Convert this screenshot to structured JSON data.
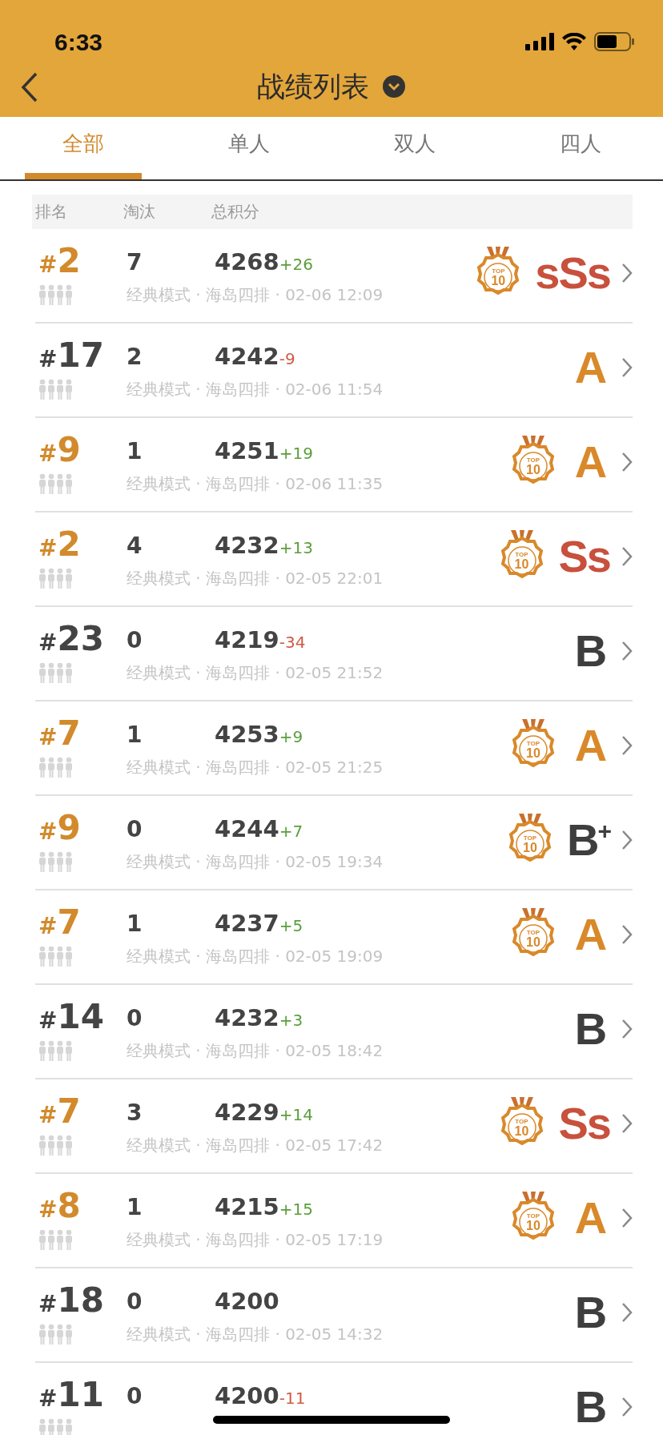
{
  "status_bar": {
    "time": "6:33"
  },
  "header": {
    "title": "战绩列表"
  },
  "tabs": [
    {
      "label": "全部",
      "selected": true
    },
    {
      "label": "单人",
      "selected": false
    },
    {
      "label": "双人",
      "selected": false
    },
    {
      "label": "四人",
      "selected": false
    }
  ],
  "table": {
    "columns": [
      "排名",
      "淘汰",
      "总积分"
    ],
    "rows": [
      {
        "rank_mark": "#",
        "rank": "2",
        "kills": "7",
        "score": "4268",
        "delta": {
          "text": "+26",
          "kind": "gain"
        },
        "meta": "经典模式 · 海岛四排 · 02-06 12:09",
        "medal": {
          "top": "TOP",
          "num": "10"
        },
        "grade": {
          "text": "sSs",
          "color": "#c8503c"
        }
      },
      {
        "rank_mark": "#",
        "rank": "17",
        "kills": "2",
        "score": "4242",
        "delta": {
          "text": "-9",
          "kind": "loss"
        },
        "meta": "经典模式 · 海岛四排 · 02-06 11:54",
        "grade": {
          "text": "A",
          "color": "#d9892a"
        }
      },
      {
        "rank_mark": "#",
        "rank": "9",
        "kills": "1",
        "score": "4251",
        "delta": {
          "text": "+19",
          "kind": "gain"
        },
        "meta": "经典模式 · 海岛四排 · 02-06 11:35",
        "medal": {
          "top": "TOP",
          "num": "10"
        },
        "grade": {
          "text": "A",
          "color": "#d9892a"
        }
      },
      {
        "rank_mark": "#",
        "rank": "2",
        "kills": "4",
        "score": "4232",
        "delta": {
          "text": "+13",
          "kind": "gain"
        },
        "meta": "经典模式 · 海岛四排 · 02-05 22:01",
        "medal": {
          "top": "TOP",
          "num": "10"
        },
        "grade": {
          "text": "Ss",
          "color": "#c8503c"
        }
      },
      {
        "rank_mark": "#",
        "rank": "23",
        "kills": "0",
        "score": "4219",
        "delta": {
          "text": "-34",
          "kind": "loss"
        },
        "meta": "经典模式 · 海岛四排 · 02-05 21:52",
        "grade": {
          "text": "B",
          "color": "#3e3e3e"
        }
      },
      {
        "rank_mark": "#",
        "rank": "7",
        "kills": "1",
        "score": "4253",
        "delta": {
          "text": "+9",
          "kind": "gain"
        },
        "meta": "经典模式 · 海岛四排 · 02-05 21:25",
        "medal": {
          "top": "TOP",
          "num": "10"
        },
        "grade": {
          "text": "A",
          "color": "#d9892a"
        }
      },
      {
        "rank_mark": "#",
        "rank": "9",
        "kills": "0",
        "score": "4244",
        "delta": {
          "text": "+7",
          "kind": "gain"
        },
        "meta": "经典模式 · 海岛四排 · 02-05 19:34",
        "medal": {
          "top": "TOP",
          "num": "10"
        },
        "grade": {
          "text": "B$^{+}$",
          "color": "#3e3e3e"
        }
      },
      {
        "rank_mark": "#",
        "rank": "7",
        "kills": "1",
        "score": "4237",
        "delta": {
          "text": "+5",
          "kind": "gain"
        },
        "meta": "经典模式 · 海岛四排 · 02-05 19:09",
        "medal": {
          "top": "TOP",
          "num": "10"
        },
        "grade": {
          "text": "A",
          "color": "#d9892a"
        }
      },
      {
        "rank_mark": "#",
        "rank": "14",
        "kills": "0",
        "score": "4232",
        "delta": {
          "text": "+3",
          "kind": "gain"
        },
        "meta": "经典模式 · 海岛四排 · 02-05 18:42",
        "grade": {
          "text": "B",
          "color": "#3e3e3e"
        }
      },
      {
        "rank_mark": "#",
        "rank": "7",
        "kills": "3",
        "score": "4229",
        "delta": {
          "text": "+14",
          "kind": "gain"
        },
        "meta": "经典模式 · 海岛四排 · 02-05 17:42",
        "medal": {
          "top": "TOP",
          "num": "10"
        },
        "grade": {
          "text": "Ss",
          "color": "#c8503c"
        }
      },
      {
        "rank_mark": "#",
        "rank": "8",
        "kills": "1",
        "score": "4215",
        "delta": {
          "text": "+15",
          "kind": "gain"
        },
        "meta": "经典模式 · 海岛四排 · 02-05 17:19",
        "medal": {
          "top": "TOP",
          "num": "10"
        },
        "grade": {
          "text": "A",
          "color": "#d9892a"
        }
      },
      {
        "rank_mark": "#",
        "rank": "18",
        "kills": "0",
        "score": "4200",
        "meta": "经典模式 · 海岛四排 · 02-05 14:32",
        "grade": {
          "text": "B",
          "color": "#3e3e3e"
        }
      },
      {
        "rank_mark": "#",
        "rank": "11",
        "kills": "0",
        "score": "4200",
        "delta": {
          "text": "-11",
          "kind": "loss"
        },
        "grade": {
          "text": "B",
          "color": "#3e3e3e"
        }
      }
    ]
  }
}
